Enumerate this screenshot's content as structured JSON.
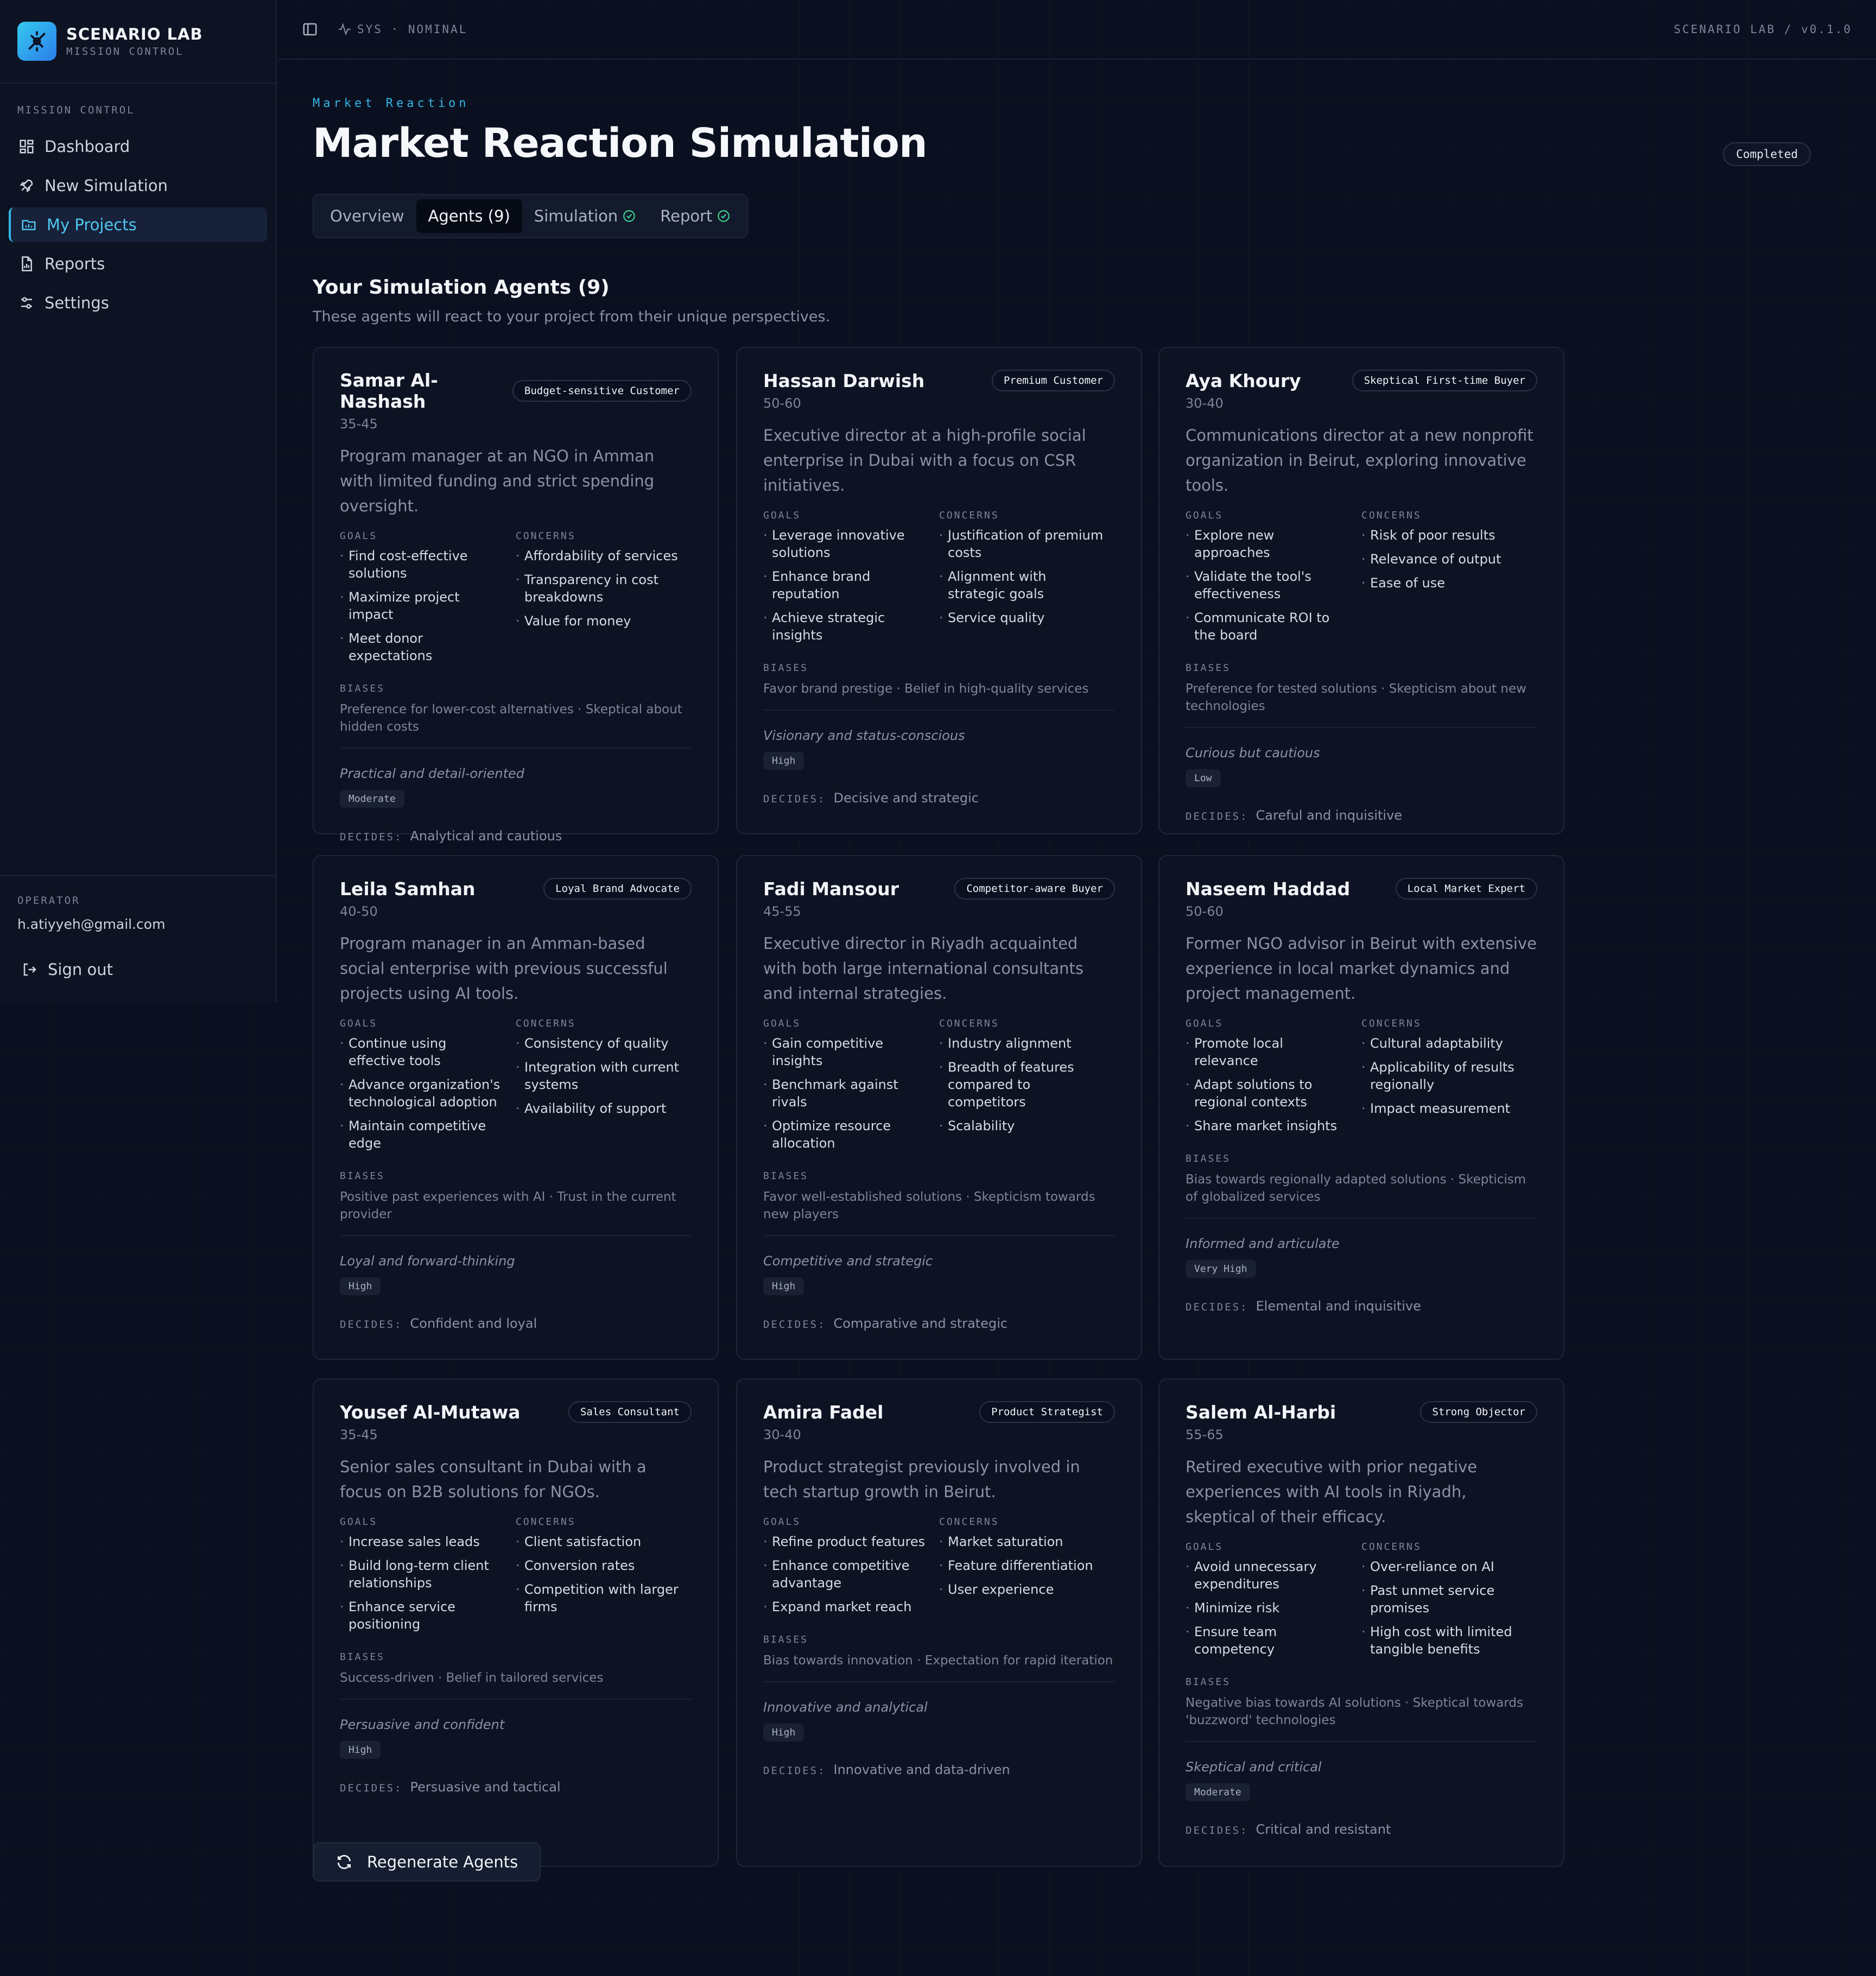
{
  "app": {
    "brand_title": "SCENARIO LAB",
    "brand_subtitle": "MISSION CONTROL",
    "version": "SCENARIO LAB / v0.1.0",
    "sys_status": "SYS · NOMINAL"
  },
  "sidebar": {
    "section_label": "MISSION CONTROL",
    "items": [
      {
        "label": "Dashboard",
        "icon": "grid-icon"
      },
      {
        "label": "New Simulation",
        "icon": "rocket-icon"
      },
      {
        "label": "My Projects",
        "icon": "folder-icon",
        "active": true
      },
      {
        "label": "Reports",
        "icon": "file-chart-icon"
      },
      {
        "label": "Settings",
        "icon": "sliders-icon"
      }
    ],
    "operator_label": "OPERATOR",
    "operator_email": "h.atiyyeh@gmail.com",
    "signout_label": "Sign out"
  },
  "page": {
    "eyebrow": "Market Reaction",
    "title": "Market Reaction Simulation",
    "status": "Completed",
    "tabs": [
      {
        "label": "Overview"
      },
      {
        "label": "Agents (9)",
        "active": true
      },
      {
        "label": "Simulation",
        "check": true
      },
      {
        "label": "Report",
        "check": true
      }
    ],
    "section_title": "Your Simulation Agents (9)",
    "section_subtitle": "These agents will react to your project from their unique perspectives.",
    "goals_label": "GOALS",
    "concerns_label": "CONCERNS",
    "biases_label": "BIASES",
    "decides_label": "DECIDES:",
    "regenerate_label": "Regenerate Agents"
  },
  "colors": {
    "accent": "#33b6e3",
    "background": "#0b1020",
    "success": "#3ecf8e"
  },
  "agents": [
    {
      "name": "Samar Al-Nashash",
      "role": "Budget-sensitive Customer",
      "age": "35-45",
      "description": "Program manager at an NGO in Amman with limited funding and strict spending oversight.",
      "goals": [
        "Find cost-effective solutions",
        "Maximize project impact",
        "Meet donor expectations"
      ],
      "concerns": [
        "Affordability of services",
        "Transparency in cost breakdowns",
        "Value for money"
      ],
      "biases": "Preference for lower-cost alternatives · Skeptical about hidden costs",
      "persona": "Practical and detail-oriented",
      "level": "Moderate",
      "decides": "Analytical and cautious"
    },
    {
      "name": "Hassan Darwish",
      "role": "Premium Customer",
      "age": "50-60",
      "description": "Executive director at a high-profile social enterprise in Dubai with a focus on CSR initiatives.",
      "goals": [
        "Leverage innovative solutions",
        "Enhance brand reputation",
        "Achieve strategic insights"
      ],
      "concerns": [
        "Justification of premium costs",
        "Alignment with strategic goals",
        "Service quality"
      ],
      "biases": "Favor brand prestige · Belief in high-quality services",
      "persona": "Visionary and status-conscious",
      "level": "High",
      "decides": "Decisive and strategic"
    },
    {
      "name": "Aya Khoury",
      "role": "Skeptical First-time Buyer",
      "age": "30-40",
      "description": "Communications director at a new nonprofit organization in Beirut, exploring innovative tools.",
      "goals": [
        "Explore new approaches",
        "Validate the tool's effectiveness",
        "Communicate ROI to the board"
      ],
      "concerns": [
        "Risk of poor results",
        "Relevance of output",
        "Ease of use"
      ],
      "biases": "Preference for tested solutions · Skepticism about new technologies",
      "persona": "Curious but cautious",
      "level": "Low",
      "decides": "Careful and inquisitive"
    },
    {
      "name": "Leila Samhan",
      "role": "Loyal Brand Advocate",
      "age": "40-50",
      "description": "Program manager in an Amman-based social enterprise with previous successful projects using AI tools.",
      "goals": [
        "Continue using effective tools",
        "Advance organization's technological adoption",
        "Maintain competitive edge"
      ],
      "concerns": [
        "Consistency of quality",
        "Integration with current systems",
        "Availability of support"
      ],
      "biases": "Positive past experiences with AI · Trust in the current provider",
      "persona": "Loyal and forward-thinking",
      "level": "High",
      "decides": "Confident and loyal"
    },
    {
      "name": "Fadi Mansour",
      "role": "Competitor-aware Buyer",
      "age": "45-55",
      "description": "Executive director in Riyadh acquainted with both large international consultants and internal strategies.",
      "goals": [
        "Gain competitive insights",
        "Benchmark against rivals",
        "Optimize resource allocation"
      ],
      "concerns": [
        "Industry alignment",
        "Breadth of features compared to competitors",
        "Scalability"
      ],
      "biases": "Favor well-established solutions · Skepticism towards new players",
      "persona": "Competitive and strategic",
      "level": "High",
      "decides": "Comparative and strategic"
    },
    {
      "name": "Naseem Haddad",
      "role": "Local Market Expert",
      "age": "50-60",
      "description": "Former NGO advisor in Beirut with extensive experience in local market dynamics and project management.",
      "goals": [
        "Promote local relevance",
        "Adapt solutions to regional contexts",
        "Share market insights"
      ],
      "concerns": [
        "Cultural adaptability",
        "Applicability of results regionally",
        "Impact measurement"
      ],
      "biases": "Bias towards regionally adapted solutions · Skepticism of globalized services",
      "persona": "Informed and articulate",
      "level": "Very High",
      "decides": "Elemental and inquisitive"
    },
    {
      "name": "Yousef Al-Mutawa",
      "role": "Sales Consultant",
      "age": "35-45",
      "description": "Senior sales consultant in Dubai with a focus on B2B solutions for NGOs.",
      "goals": [
        "Increase sales leads",
        "Build long-term client relationships",
        "Enhance service positioning"
      ],
      "concerns": [
        "Client satisfaction",
        "Conversion rates",
        "Competition with larger firms"
      ],
      "biases": "Success-driven · Belief in tailored services",
      "persona": "Persuasive and confident",
      "level": "High",
      "decides": "Persuasive and tactical"
    },
    {
      "name": "Amira Fadel",
      "role": "Product Strategist",
      "age": "30-40",
      "description": "Product strategist previously involved in tech startup growth in Beirut.",
      "goals": [
        "Refine product features",
        "Enhance competitive advantage",
        "Expand market reach"
      ],
      "concerns": [
        "Market saturation",
        "Feature differentiation",
        "User experience"
      ],
      "biases": "Bias towards innovation · Expectation for rapid iteration",
      "persona": "Innovative and analytical",
      "level": "High",
      "decides": "Innovative and data-driven"
    },
    {
      "name": "Salem Al-Harbi",
      "role": "Strong Objector",
      "age": "55-65",
      "description": "Retired executive with prior negative experiences with AI tools in Riyadh, skeptical of their efficacy.",
      "goals": [
        "Avoid unnecessary expenditures",
        "Minimize risk",
        "Ensure team competency"
      ],
      "concerns": [
        "Over-reliance on AI",
        "Past unmet service promises",
        "High cost with limited tangible benefits"
      ],
      "biases": "Negative bias towards AI solutions · Skeptical towards 'buzzword' technologies",
      "persona": "Skeptical and critical",
      "level": "Moderate",
      "decides": "Critical and resistant"
    }
  ]
}
